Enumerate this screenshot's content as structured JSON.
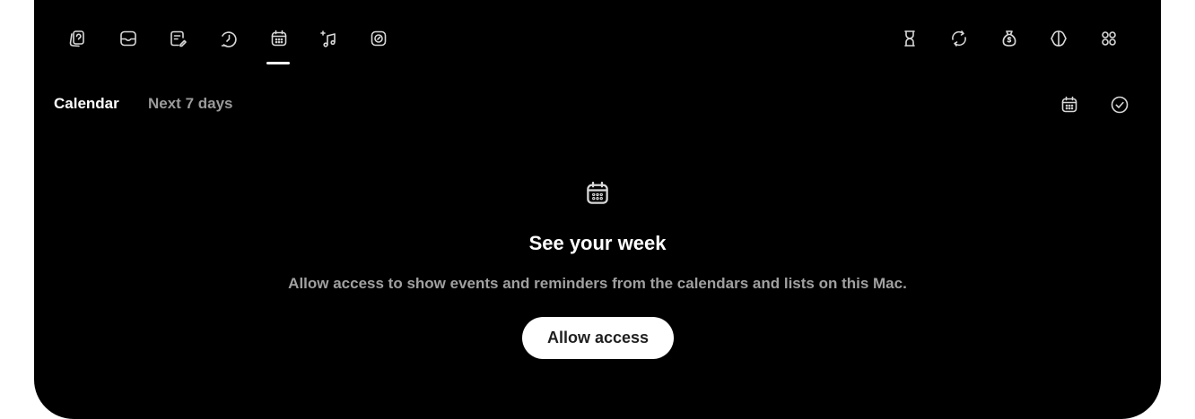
{
  "toolbar": {
    "left_icons": [
      {
        "name": "cards-icon",
        "active": false
      },
      {
        "name": "inbox-icon",
        "active": false
      },
      {
        "name": "notes-icon",
        "active": false
      },
      {
        "name": "clock-refresh-icon",
        "active": false
      },
      {
        "name": "calendar-icon",
        "active": true
      },
      {
        "name": "music-icon",
        "active": false
      },
      {
        "name": "compass-icon",
        "active": false
      }
    ],
    "right_icons": [
      {
        "name": "hourglass-icon"
      },
      {
        "name": "sync-icon"
      },
      {
        "name": "money-bag-icon"
      },
      {
        "name": "contrast-icon"
      },
      {
        "name": "grid-icon"
      }
    ]
  },
  "section": {
    "title": "Calendar",
    "subtitle": "Next 7 days"
  },
  "empty_state": {
    "icon": "calendar-icon",
    "title": "See your week",
    "description": "Allow access to show events and reminders from the calendars and lists on this Mac.",
    "button_label": "Allow access"
  },
  "colors": {
    "background": "#000000",
    "text_primary": "#ffffff",
    "text_secondary": "#9a9a9a",
    "button_bg": "#ffffff"
  }
}
